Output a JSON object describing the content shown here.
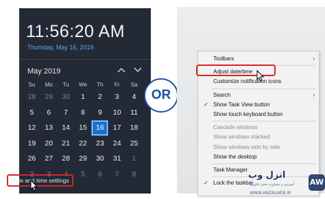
{
  "calendar_flyout": {
    "time": "11:56:20 AM",
    "date": "Thursday, May 16, 2019",
    "month_label": "May 2019",
    "nav_up_icon": "chevron-up-icon",
    "nav_down_icon": "chevron-down-icon",
    "weekdays": [
      "Su",
      "Mo",
      "Tu",
      "We",
      "Th",
      "Fr",
      "Sa"
    ],
    "days": [
      {
        "label": "28",
        "dim": true
      },
      {
        "label": "29",
        "dim": true
      },
      {
        "label": "30",
        "dim": true
      },
      {
        "label": "1"
      },
      {
        "label": "2"
      },
      {
        "label": "3"
      },
      {
        "label": "4"
      },
      {
        "label": "5"
      },
      {
        "label": "6"
      },
      {
        "label": "7"
      },
      {
        "label": "8"
      },
      {
        "label": "9"
      },
      {
        "label": "10"
      },
      {
        "label": "11"
      },
      {
        "label": "12"
      },
      {
        "label": "13"
      },
      {
        "label": "14"
      },
      {
        "label": "15"
      },
      {
        "label": "16",
        "today": true
      },
      {
        "label": "17"
      },
      {
        "label": "18"
      },
      {
        "label": "19"
      },
      {
        "label": "20"
      },
      {
        "label": "21"
      },
      {
        "label": "22"
      },
      {
        "label": "23"
      },
      {
        "label": "24"
      },
      {
        "label": "25"
      },
      {
        "label": "26"
      },
      {
        "label": "27"
      },
      {
        "label": "28"
      },
      {
        "label": "29"
      },
      {
        "label": "30"
      },
      {
        "label": "31"
      },
      {
        "label": "1",
        "dim": true
      },
      {
        "label": "2",
        "dim": true
      },
      {
        "label": "3",
        "dim": true
      },
      {
        "label": "4",
        "dim": true
      },
      {
        "label": "5",
        "dim": true
      },
      {
        "label": "6",
        "dim": true
      },
      {
        "label": "7",
        "dim": true
      },
      {
        "label": "8",
        "dim": true
      }
    ],
    "settings_link": "Date and time settings",
    "highlight_color": "#d4262b",
    "today_color": "#1f6fd1"
  },
  "or_badge": {
    "label": "OR",
    "color": "#1e4ea3"
  },
  "context_menu": {
    "items": [
      {
        "label": "Toolbars",
        "submenu": true
      },
      {
        "sep": true
      },
      {
        "label": "Adjust date/time",
        "highlighted": true
      },
      {
        "label": "Customize notification icons"
      },
      {
        "sep": true
      },
      {
        "label": "Search",
        "submenu": true
      },
      {
        "label": "Show Task View button",
        "checked": true
      },
      {
        "label": "Show touch keyboard button"
      },
      {
        "sep": true
      },
      {
        "label": "Cascade windows",
        "disabled": true
      },
      {
        "label": "Show windows stacked",
        "disabled": true
      },
      {
        "label": "Show windows side by side",
        "disabled": true
      },
      {
        "label": "Show the desktop"
      },
      {
        "sep": true
      },
      {
        "label": "Task Manager"
      },
      {
        "sep": true
      },
      {
        "label": "Lock the taskbar",
        "checked": true
      }
    ]
  },
  "watermark": {
    "text": "انزل وب",
    "subtitle": "آموزش و مشاوره بخش فناوری",
    "url": "WWW.ANZALWEB.IR",
    "mark": "AW"
  }
}
